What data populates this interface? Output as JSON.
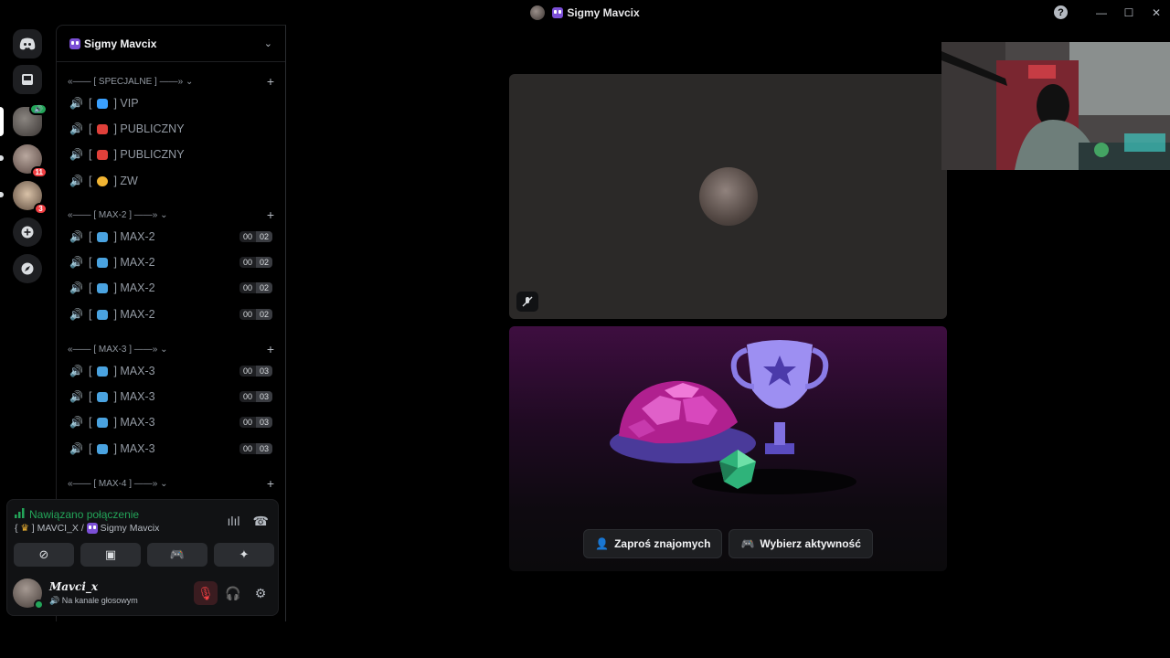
{
  "window": {
    "title": "Sigmy Mavcix",
    "controls": [
      "help",
      "minimize",
      "maximize",
      "close"
    ]
  },
  "rail": {
    "items": [
      {
        "name": "discord-home",
        "icon": "discord-icon"
      },
      {
        "name": "inbox",
        "icon": "inbox-icon"
      },
      {
        "name": "server-1",
        "badge": "🔊"
      },
      {
        "name": "server-2",
        "badge": "11"
      },
      {
        "name": "server-3",
        "badge": "3"
      },
      {
        "name": "add-server",
        "icon": "plus-icon"
      },
      {
        "name": "discover",
        "icon": "compass-icon"
      }
    ]
  },
  "guild": {
    "name": "Sigmy Mavcix"
  },
  "categories": [
    {
      "label": "«—— [ SPECJALNE ] ——»"
    },
    {
      "label": "«—— [ MAX-2 ] ——»"
    },
    {
      "label": "«—— [ MAX-3 ] ——»"
    },
    {
      "label": "«—— [ MAX-4 ] ——»"
    }
  ],
  "channels": {
    "special": [
      {
        "prefix": "[",
        "tag_color": "#3aa0ff",
        "name": "] VIP"
      },
      {
        "prefix": "[",
        "tag_color": "#e0403a",
        "name": "] PUBLICZNY"
      },
      {
        "prefix": "[",
        "tag_color": "#e0403a",
        "name": "] PUBLICZNY"
      },
      {
        "prefix": "[",
        "tag_color": "#f2b533",
        "name": "] ZW"
      }
    ],
    "max2": [
      {
        "prefix": "[",
        "tag_color": "#4aa3e0",
        "name": "] MAX-2",
        "count_a": "00",
        "count_b": "02"
      },
      {
        "prefix": "[",
        "tag_color": "#4aa3e0",
        "name": "] MAX-2",
        "count_a": "00",
        "count_b": "02"
      },
      {
        "prefix": "[",
        "tag_color": "#4aa3e0",
        "name": "] MAX-2",
        "count_a": "00",
        "count_b": "02"
      },
      {
        "prefix": "[",
        "tag_color": "#4aa3e0",
        "name": "] MAX-2",
        "count_a": "00",
        "count_b": "02"
      }
    ],
    "max3": [
      {
        "prefix": "[",
        "tag_color": "#4aa3e0",
        "name": "] MAX-3",
        "count_a": "00",
        "count_b": "03"
      },
      {
        "prefix": "[",
        "tag_color": "#4aa3e0",
        "name": "] MAX-3",
        "count_a": "00",
        "count_b": "03"
      },
      {
        "prefix": "[",
        "tag_color": "#4aa3e0",
        "name": "] MAX-3",
        "count_a": "00",
        "count_b": "03"
      },
      {
        "prefix": "[",
        "tag_color": "#4aa3e0",
        "name": "] MAX-3",
        "count_a": "00",
        "count_b": "03"
      }
    ]
  },
  "voice": {
    "status": "Nawiązano połączenie",
    "channel_prefix": "{",
    "channel_mid": "] MAVCI_X /",
    "server_name": "Sigmy Mavcix",
    "status_color": "#23a559"
  },
  "user": {
    "name": "Mavci_x",
    "sub": "Na kanale głosowym"
  },
  "stage": {
    "invite_label": "Zaproś znajomych",
    "activity_label": "Wybierz aktywność"
  },
  "colors": {
    "accent_green": "#23a559",
    "danger": "#f23f43"
  }
}
